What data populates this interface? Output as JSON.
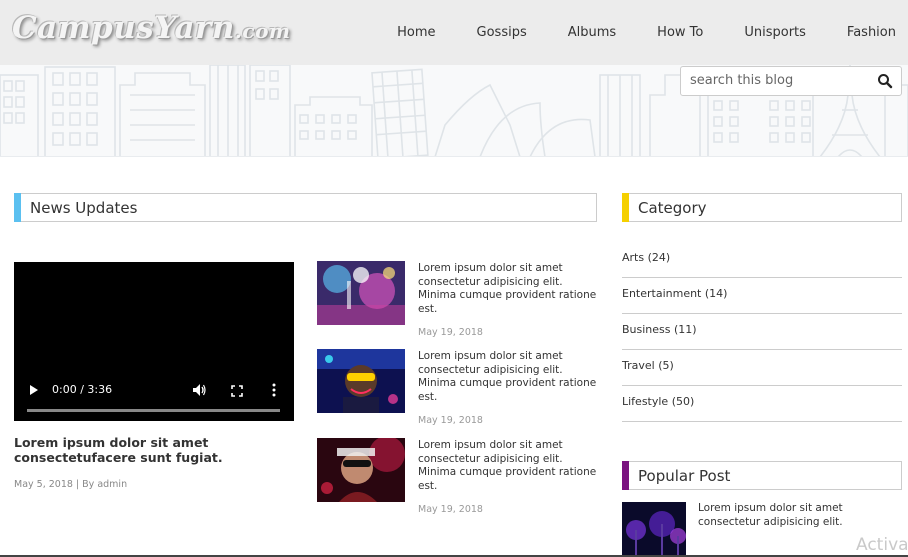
{
  "header": {
    "logo_text": "CampusYarn",
    "logo_suffix": ".com",
    "nav": [
      "Home",
      "Gossips",
      "Albums",
      "How To",
      "Unisports",
      "Fashion"
    ]
  },
  "search": {
    "placeholder": "search this blog",
    "icon": "search-icon"
  },
  "news_updates": {
    "title": "News Updates",
    "accent_color": "#5bc0f0",
    "video": {
      "time": "0:00 / 3:36"
    },
    "main_post": {
      "title": "Lorem ipsum dolor sit amet consectetufacere sunt fugiat.",
      "meta": "May 5, 2018 | By admin"
    },
    "items": [
      {
        "text": "Lorem ipsum dolor sit amet consectetur adipisicing elit. Minima cumque provident ratione est.",
        "date": "May 19, 2018"
      },
      {
        "text": "Lorem ipsum dolor sit amet consectetur adipisicing elit. Minima cumque provident ratione est.",
        "date": "May 19, 2018"
      },
      {
        "text": "Lorem ipsum dolor sit amet consectetur adipisicing elit. Minima cumque provident ratione est.",
        "date": "May 19, 2018"
      }
    ]
  },
  "category": {
    "title": "Category",
    "accent_color": "#f5d000",
    "items": [
      "Arts (24)",
      "Entertainment (14)",
      "Business (11)",
      "Travel (5)",
      "Lifestyle (50)"
    ]
  },
  "popular": {
    "title": "Popular Post",
    "accent_color": "#7a1380",
    "post_text": "Lorem ipsum dolor sit amet consectetur adipisicing elit."
  },
  "watermark": "Activa"
}
